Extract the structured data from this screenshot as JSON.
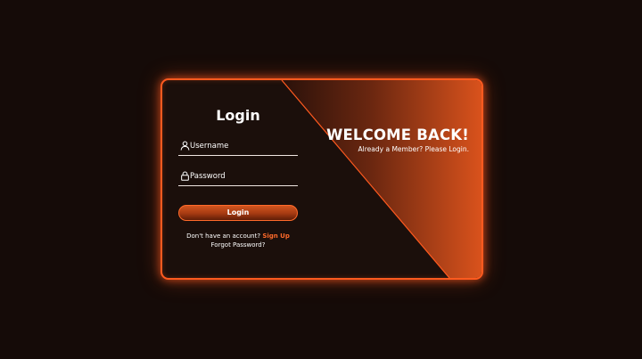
{
  "login": {
    "title": "Login",
    "username_placeholder": "Username",
    "password_placeholder": "Password",
    "button_label": "Login",
    "signup_prompt": "Don't have an account?",
    "signup_link": "Sign Up",
    "forgot_link": "Forgot Password?"
  },
  "welcome": {
    "title": "WELCOME BACK!",
    "subtitle": "Already a Member? Please Login."
  },
  "icons": {
    "username": "user-icon",
    "password": "lock-icon"
  },
  "colors": {
    "background": "#150b08",
    "card": "#1b0f0b",
    "accent": "#ff5a1f",
    "accent_dark": "#4a1a0b",
    "text": "#ffffff",
    "link": "#ff6a2a"
  }
}
